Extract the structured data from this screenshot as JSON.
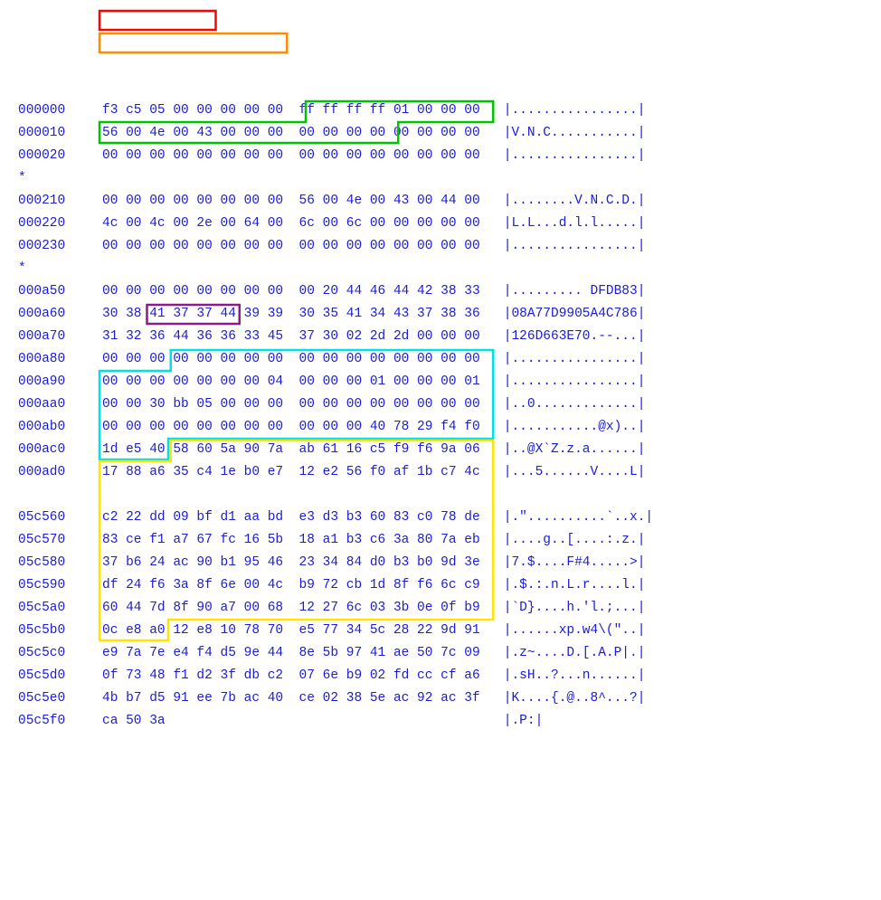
{
  "hexdump": {
    "rows": [
      {
        "offset": "000000",
        "hex1": "f3 c5 05 00 00 00 00 00",
        "hex2": "ff ff ff ff 01 00 00 00",
        "ascii": "|................|"
      },
      {
        "offset": "000010",
        "hex1": "56 00 4e 00 43 00 00 00",
        "hex2": "00 00 00 00 00 00 00 00",
        "ascii": "|V.N.C...........|"
      },
      {
        "offset": "000020",
        "hex1": "00 00 00 00 00 00 00 00",
        "hex2": "00 00 00 00 00 00 00 00",
        "ascii": "|................|"
      },
      {
        "offset": "*",
        "hex1": "",
        "hex2": "",
        "ascii": ""
      },
      {
        "offset": "000210",
        "hex1": "00 00 00 00 00 00 00 00",
        "hex2": "56 00 4e 00 43 00 44 00",
        "ascii": "|........V.N.C.D.|"
      },
      {
        "offset": "000220",
        "hex1": "4c 00 4c 00 2e 00 64 00",
        "hex2": "6c 00 6c 00 00 00 00 00",
        "ascii": "|L.L...d.l.l.....|"
      },
      {
        "offset": "000230",
        "hex1": "00 00 00 00 00 00 00 00",
        "hex2": "00 00 00 00 00 00 00 00",
        "ascii": "|................|"
      },
      {
        "offset": "*",
        "hex1": "",
        "hex2": "",
        "ascii": ""
      },
      {
        "offset": "000a50",
        "hex1": "00 00 00 00 00 00 00 00",
        "hex2": "00 20 44 46 44 42 38 33",
        "ascii": "|......... DFDB83|"
      },
      {
        "offset": "000a60",
        "hex1": "30 38 41 37 37 44 39 39",
        "hex2": "30 35 41 34 43 37 38 36",
        "ascii": "|08A77D9905A4C786|"
      },
      {
        "offset": "000a70",
        "hex1": "31 32 36 44 36 36 33 45",
        "hex2": "37 30 02 2d 2d 00 00 00",
        "ascii": "|126D663E70.--...|"
      },
      {
        "offset": "000a80",
        "hex1": "00 00 00 00 00 00 00 00",
        "hex2": "00 00 00 00 00 00 00 00",
        "ascii": "|................|"
      },
      {
        "offset": "000a90",
        "hex1": "00 00 00 00 00 00 00 04",
        "hex2": "00 00 00 01 00 00 00 01",
        "ascii": "|................|"
      },
      {
        "offset": "000aa0",
        "hex1": "00 00 30 bb 05 00 00 00",
        "hex2": "00 00 00 00 00 00 00 00",
        "ascii": "|..0.............|"
      },
      {
        "offset": "000ab0",
        "hex1": "00 00 00 00 00 00 00 00",
        "hex2": "00 00 00 40 78 29 f4 f0",
        "ascii": "|...........@x)..|"
      },
      {
        "offset": "000ac0",
        "hex1": "1d e5 40 58 60 5a 90 7a",
        "hex2": "ab 61 16 c5 f9 f6 9a 06",
        "ascii": "|..@X`Z.z.a......|"
      },
      {
        "offset": "000ad0",
        "hex1": "17 88 a6 35 c4 1e b0 e7",
        "hex2": "12 e2 56 f0 af 1b c7 4c",
        "ascii": "|...5......V....L|"
      },
      {
        "offset": "",
        "hex1": "",
        "hex2": "",
        "ascii": ""
      },
      {
        "offset": "05c560",
        "hex1": "c2 22 dd 09 bf d1 aa bd",
        "hex2": "e3 d3 b3 60 83 c0 78 de",
        "ascii": "|.\"..........`..x.|"
      },
      {
        "offset": "05c570",
        "hex1": "83 ce f1 a7 67 fc 16 5b",
        "hex2": "18 a1 b3 c6 3a 80 7a eb",
        "ascii": "|....g..[....:.z.|"
      },
      {
        "offset": "05c580",
        "hex1": "37 b6 24 ac 90 b1 95 46",
        "hex2": "23 34 84 d0 b3 b0 9d 3e",
        "ascii": "|7.$....F#4.....>|"
      },
      {
        "offset": "05c590",
        "hex1": "df 24 f6 3a 8f 6e 00 4c",
        "hex2": "b9 72 cb 1d 8f f6 6c c9",
        "ascii": "|.$.:.n.L.r....l.|"
      },
      {
        "offset": "05c5a0",
        "hex1": "60 44 7d 8f 90 a7 00 68",
        "hex2": "12 27 6c 03 3b 0e 0f b9",
        "ascii": "|`D}....h.'l.;...|"
      },
      {
        "offset": "05c5b0",
        "hex1": "0c e8 a0 12 e8 10 78 70",
        "hex2": "e5 77 34 5c 28 22 9d 91",
        "ascii": "|......xp.w4\\(\"..|"
      },
      {
        "offset": "05c5c0",
        "hex1": "e9 7a 7e e4 f4 d5 9e 44",
        "hex2": "8e 5b 97 41 ae 50 7c 09",
        "ascii": "|.z~....D.[.A.P|.|"
      },
      {
        "offset": "05c5d0",
        "hex1": "0f 73 48 f1 d2 3f db c2",
        "hex2": "07 6e b9 02 fd cc cf a6",
        "ascii": "|.sH..?...n......|"
      },
      {
        "offset": "05c5e0",
        "hex1": "4b b7 d5 91 ee 7b ac 40",
        "hex2": "ce 02 38 5e ac 92 ac 3f",
        "ascii": "|K....{.@..8^...?|"
      },
      {
        "offset": "05c5f0",
        "hex1": "ca 50 3a",
        "hex2": "",
        "ascii": "|.P:|"
      }
    ]
  },
  "highlights": {
    "red": {
      "row": 0,
      "startByte": 0,
      "endByte": 4
    },
    "orange": {
      "row": 1,
      "startByte": 0,
      "endByte": 7
    },
    "green_a": {
      "row": 4,
      "startByte": 8,
      "endByte": 15
    },
    "green_b": {
      "row": 5,
      "startByte": 0,
      "endByte": 11
    },
    "purple": {
      "row": 13,
      "startByte": 2,
      "endByte": 5
    },
    "cyan_a": {
      "row": 15,
      "startByte": 3,
      "endByte": 15
    },
    "cyan_b": {
      "row": 16,
      "startByte": 0,
      "endByte": 15
    },
    "cyan_c": {
      "row": 18,
      "startByte": 0,
      "endByte": 15
    },
    "cyan_d": {
      "row": 19,
      "startByte": 0,
      "endByte": 2
    },
    "yellow_a": {
      "row": 19,
      "startByte": 3,
      "endByte": 15
    },
    "yellow_b": {
      "rowStart": 20,
      "rowEnd": 26,
      "startByte": 0,
      "endByte": 15
    },
    "yellow_c": {
      "row": 27,
      "startByte": 0,
      "endByte": 2
    }
  },
  "colors": {
    "red": "#ff0000",
    "orange": "#ff8b00",
    "green": "#00c400",
    "purple": "#8b1a8b",
    "cyan": "#00e0e8",
    "yellow": "#ffe400"
  }
}
